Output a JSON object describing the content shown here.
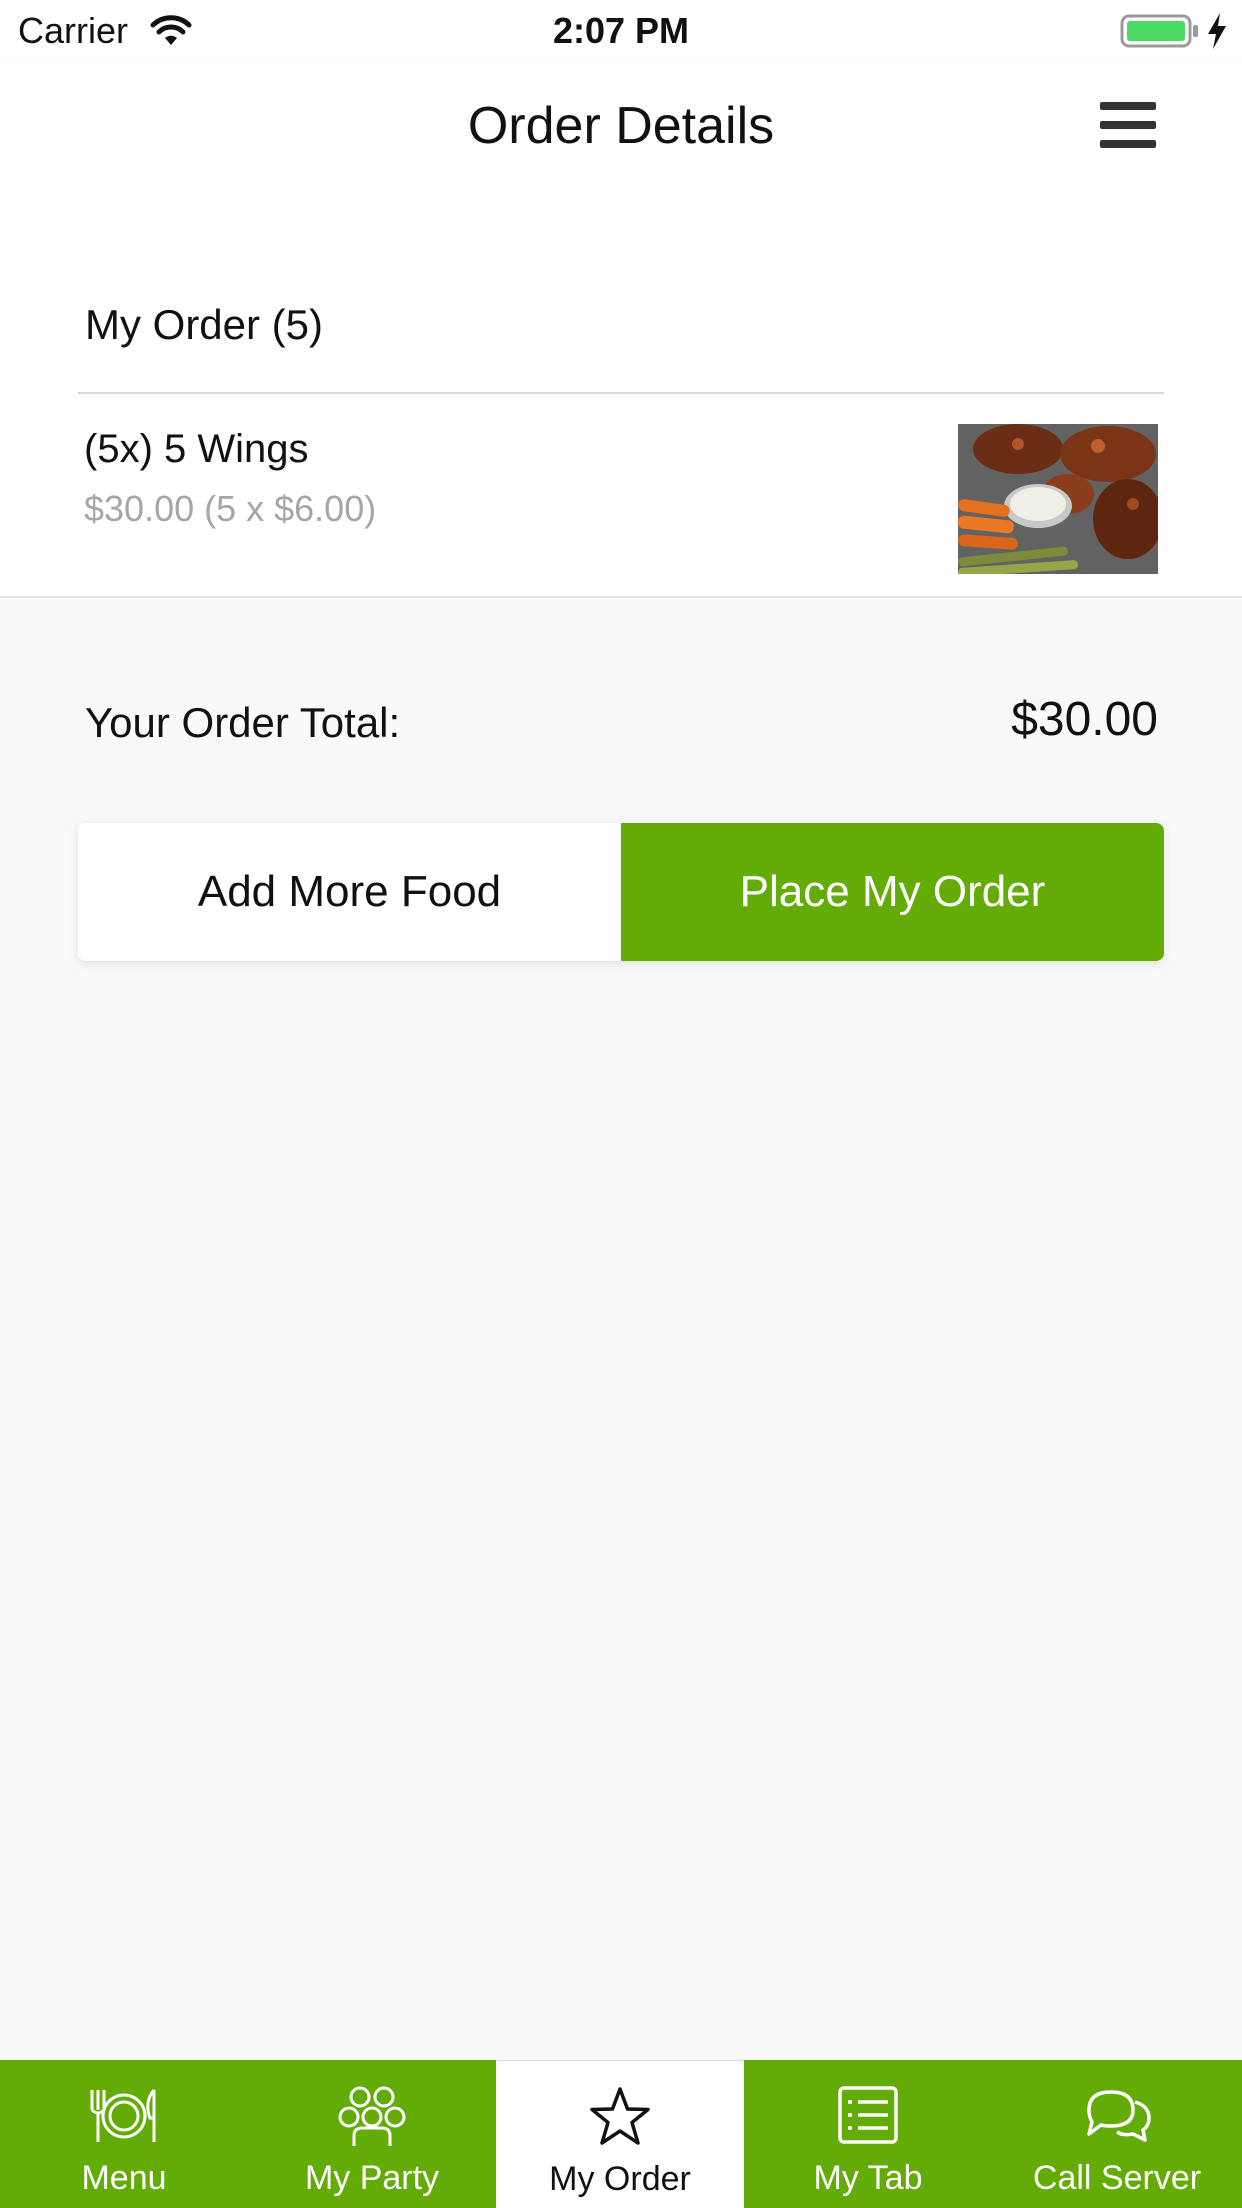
{
  "status_bar": {
    "carrier": "Carrier",
    "time": "2:07 PM"
  },
  "nav": {
    "title": "Order Details",
    "menu_icon": "hamburger-menu-icon"
  },
  "order": {
    "heading": "My Order (5)",
    "items": [
      {
        "name": "(5x) 5 Wings",
        "price": "$30.00 (5 x $6.00)",
        "image": "chicken wings with dip and veggie sticks"
      }
    ]
  },
  "totals": {
    "label": "Your Order Total:",
    "value": "$30.00"
  },
  "actions": {
    "add_more": "Add More Food",
    "place_order": "Place My Order"
  },
  "tabs": [
    {
      "label": "Menu",
      "icon": "plate-cutlery-icon",
      "active": false
    },
    {
      "label": "My Party",
      "icon": "party-people-icon",
      "active": false
    },
    {
      "label": "My Order",
      "icon": "star-icon",
      "active": true
    },
    {
      "label": "My Tab",
      "icon": "tab-list-icon",
      "active": false
    },
    {
      "label": "Call Server",
      "icon": "chat-bubbles-icon",
      "active": false
    }
  ],
  "colors": {
    "brand_green": "#63ab07",
    "background": "#f9f9f9",
    "muted_text": "#a6a6a6",
    "battery_green": "#4cd964"
  }
}
